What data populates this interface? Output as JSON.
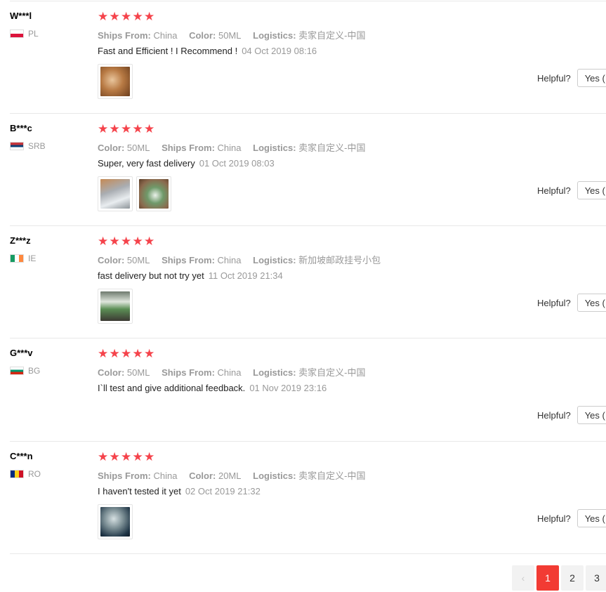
{
  "reviews": [
    {
      "user": "W***l",
      "country": "PL",
      "flag": "flag-pl",
      "attrs": [
        {
          "k": "Ships From:",
          "v": "China"
        },
        {
          "k": "Color:",
          "v": "50ML"
        },
        {
          "k": "Logistics:",
          "v": "卖家自定义-中国"
        }
      ],
      "text": "Fast and Efficient ! I Recommend !",
      "date": "04 Oct 2019 08:16",
      "helpful_label": "Helpful?",
      "yes_label": "Yes ("
    },
    {
      "user": "B***c",
      "country": "SRB",
      "flag": "flag-srb",
      "attrs": [
        {
          "k": "Color:",
          "v": "50ML"
        },
        {
          "k": "Ships From:",
          "v": "China"
        },
        {
          "k": "Logistics:",
          "v": "卖家自定义-中国"
        }
      ],
      "text": "Super, very fast delivery",
      "date": "01 Oct 2019 08:03",
      "helpful_label": "Helpful?",
      "yes_label": "Yes ("
    },
    {
      "user": "Z***z",
      "country": "IE",
      "flag": "flag-ie",
      "attrs": [
        {
          "k": "Color:",
          "v": "50ML"
        },
        {
          "k": "Ships From:",
          "v": "China"
        },
        {
          "k": "Logistics:",
          "v": "新加坡邮政挂号小包"
        }
      ],
      "text": "fast delivery but not try yet",
      "date": "11 Oct 2019 21:34",
      "helpful_label": "Helpful?",
      "yes_label": "Yes ("
    },
    {
      "user": "G***v",
      "country": "BG",
      "flag": "flag-bg",
      "attrs": [
        {
          "k": "Color:",
          "v": "50ML"
        },
        {
          "k": "Ships From:",
          "v": "China"
        },
        {
          "k": "Logistics:",
          "v": "卖家自定义-中国"
        }
      ],
      "text": "I`ll test and give additional feedback.",
      "date": "01 Nov 2019 23:16",
      "helpful_label": "Helpful?",
      "yes_label": "Yes ("
    },
    {
      "user": "C***n",
      "country": "RO",
      "flag": "flag-ro",
      "attrs": [
        {
          "k": "Ships From:",
          "v": "China"
        },
        {
          "k": "Color:",
          "v": "20ML"
        },
        {
          "k": "Logistics:",
          "v": "卖家自定义-中国"
        }
      ],
      "text": "I haven't tested it yet",
      "date": "02 Oct 2019 21:32",
      "helpful_label": "Helpful?",
      "yes_label": "Yes ("
    }
  ],
  "rating_stars": 5,
  "pagination": {
    "prev": "‹",
    "pages": [
      "1",
      "2",
      "3"
    ],
    "active": "1"
  },
  "colors": {
    "star": "#f5434b",
    "active_page": "#f23b33"
  }
}
